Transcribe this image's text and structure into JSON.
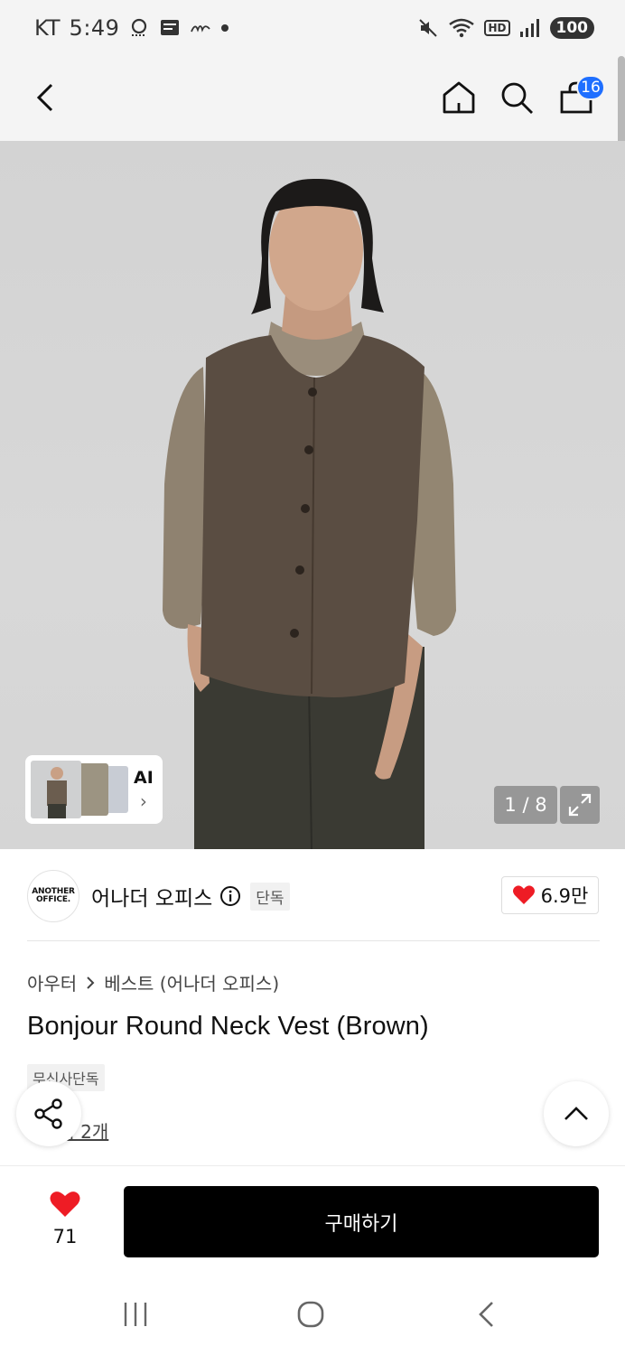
{
  "status_bar": {
    "carrier": "KT",
    "time": "5:49",
    "battery": "100",
    "hd_label": "HD"
  },
  "header": {
    "cart_count": "16"
  },
  "gallery": {
    "ai_label": "AI",
    "ai_chevron": "›",
    "pager": "1 / 8"
  },
  "brand": {
    "logo_line1": "ANOTHER",
    "logo_line2": "OFFICE.",
    "name": "어나더 오피스",
    "exclusive_badge": "단독",
    "like_count": "6.9만"
  },
  "product": {
    "category": "아우터",
    "subcategory": "베스트 (어나더 오피스)",
    "title": "Bonjour Round Neck Vest (Brown)",
    "musinsa_badge": "무신사단독",
    "review_link": "후기 2개"
  },
  "bottom_bar": {
    "wish_count": "71",
    "buy_label": "구매하기"
  },
  "colors": {
    "accent_blue": "#1f6fff",
    "heart_red": "#ee1c25",
    "buy_black": "#000000"
  }
}
